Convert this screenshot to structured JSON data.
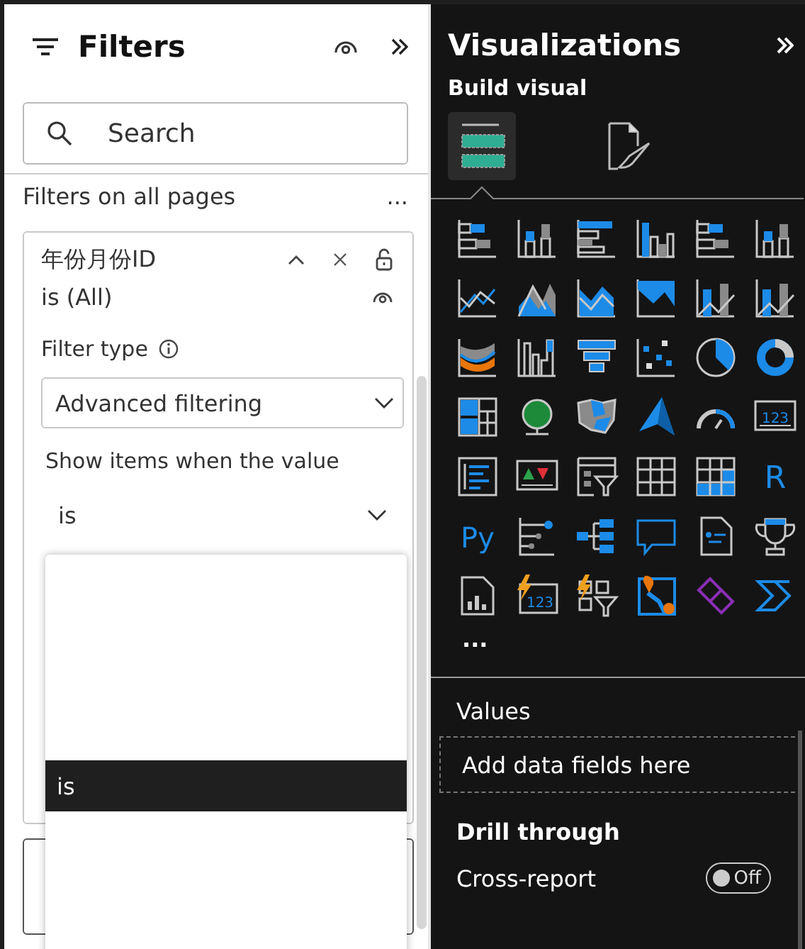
{
  "filters_pane": {
    "title": "Filters",
    "search": {
      "placeholder": "Search"
    },
    "section": {
      "title": "Filters on all pages",
      "more": "..."
    },
    "filter_card": {
      "field": "年份月份ID",
      "summary": "is (All)",
      "expanded": true,
      "filter_type_label": "Filter type",
      "filter_type": "Advanced filtering",
      "condition_label": "Show items when the value",
      "condition": "is",
      "condition_options": [
        {
          "label": "is",
          "selected": true
        }
      ]
    }
  },
  "visualizations_pane": {
    "title": "Visualizations",
    "subtitle": "Build visual",
    "tabs": [
      {
        "kind": "build",
        "selected": true
      },
      {
        "kind": "format",
        "selected": false
      }
    ],
    "visuals": [
      {
        "kind": "stacked-bar"
      },
      {
        "kind": "stacked-column"
      },
      {
        "kind": "clustered-bar"
      },
      {
        "kind": "clustered-column"
      },
      {
        "kind": "stacked-bar"
      },
      {
        "kind": "stacked-column"
      },
      {
        "kind": "line"
      },
      {
        "kind": "area"
      },
      {
        "kind": "area-line"
      },
      {
        "kind": "area-fill"
      },
      {
        "kind": "line-column"
      },
      {
        "kind": "line-column"
      },
      {
        "kind": "ribbon"
      },
      {
        "kind": "waterfall"
      },
      {
        "kind": "funnel"
      },
      {
        "kind": "scatter"
      },
      {
        "kind": "pie"
      },
      {
        "kind": "donut"
      },
      {
        "kind": "treemap"
      },
      {
        "kind": "globe"
      },
      {
        "kind": "filled-map"
      },
      {
        "kind": "arrow"
      },
      {
        "kind": "gauge"
      },
      {
        "kind": "card",
        "text": "123"
      },
      {
        "kind": "list-card"
      },
      {
        "kind": "kpi"
      },
      {
        "kind": "slicer"
      },
      {
        "kind": "table"
      },
      {
        "kind": "matrix"
      },
      {
        "kind": "letter",
        "text": "R"
      },
      {
        "kind": "letter",
        "text": "Py"
      },
      {
        "kind": "influencers"
      },
      {
        "kind": "tree"
      },
      {
        "kind": "speech"
      },
      {
        "kind": "document"
      },
      {
        "kind": "trophy"
      },
      {
        "kind": "report"
      },
      {
        "kind": "card-bolt",
        "text": "123"
      },
      {
        "kind": "slicer-bolt"
      },
      {
        "kind": "pin-map"
      },
      {
        "kind": "diamond"
      },
      {
        "kind": "chevrons"
      }
    ],
    "more": "...",
    "values_label": "Values",
    "values_placeholder": "Add data fields here",
    "drill_title": "Drill through",
    "cross_report": {
      "label": "Cross-report",
      "on": false,
      "state_text": "Off"
    }
  }
}
